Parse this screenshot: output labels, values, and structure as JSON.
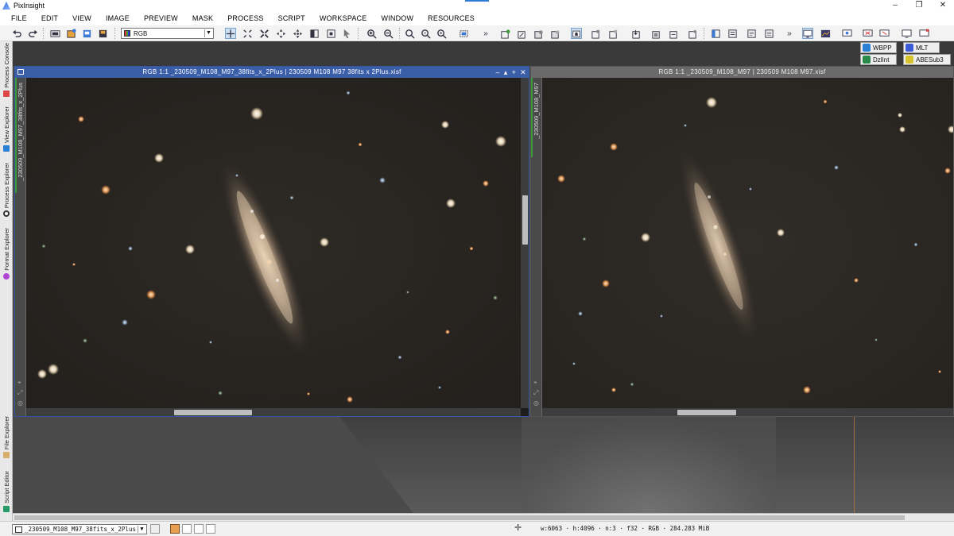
{
  "app": {
    "title": "PixInsight",
    "controls": {
      "minimize": "–",
      "maximize": "❐",
      "close": "✕"
    }
  },
  "menu": [
    "FILE",
    "EDIT",
    "VIEW",
    "IMAGE",
    "PREVIEW",
    "MASK",
    "PROCESS",
    "SCRIPT",
    "WORKSPACE",
    "WINDOW",
    "RESOURCES"
  ],
  "toolbar": {
    "view_select_value": "RGB",
    "overflow_1": "»",
    "overflow_2": "»"
  },
  "process_icons": [
    {
      "label": "WBPP",
      "color": "#2a7fd6"
    },
    {
      "label": "MLT",
      "color": "#3b5bd6"
    },
    {
      "label": "DzlInt",
      "color": "#2a8a4a"
    },
    {
      "label": "ABESub3",
      "color": "#d6c22a"
    }
  ],
  "side_tabs": [
    {
      "label": "Process Console",
      "icon_color": "#d44"
    },
    {
      "label": "View Explorer",
      "icon_color": "#2a7fd6"
    },
    {
      "label": "Process Explorer",
      "icon_color": "#333"
    },
    {
      "label": "Format Explorer",
      "icon_color": "#b044d6"
    },
    {
      "label": "File Explorer",
      "icon_color": "#d6b06a"
    },
    {
      "label": "Script Editor",
      "icon_color": "#2a9a6a"
    }
  ],
  "windows": [
    {
      "title": "RGB 1:1 _230509_M108_M97_38fits_x_2Plus | 230509 M108 M97 38fits x 2Plus.xisf",
      "tab_label": "_230509_M108_M97_38fits_x_2Plus",
      "active": true,
      "buttons": {
        "minimize": "–",
        "shade": "▴",
        "maximize": "+",
        "close": "✕"
      }
    },
    {
      "title": "RGB 1:1 _230509_M108_M97 | 230509 M108 M97.xisf",
      "tab_label": "_230509_M108_M97",
      "active": false
    }
  ],
  "status": {
    "current_view": "_230509_M108_M97_38fits_x_2Plus",
    "width": "w:6063",
    "height": "h:4096",
    "channels": "n:3",
    "sample_type": "f32",
    "color_space": "RGB",
    "size": "284.283 MiB",
    "separator": "·"
  }
}
